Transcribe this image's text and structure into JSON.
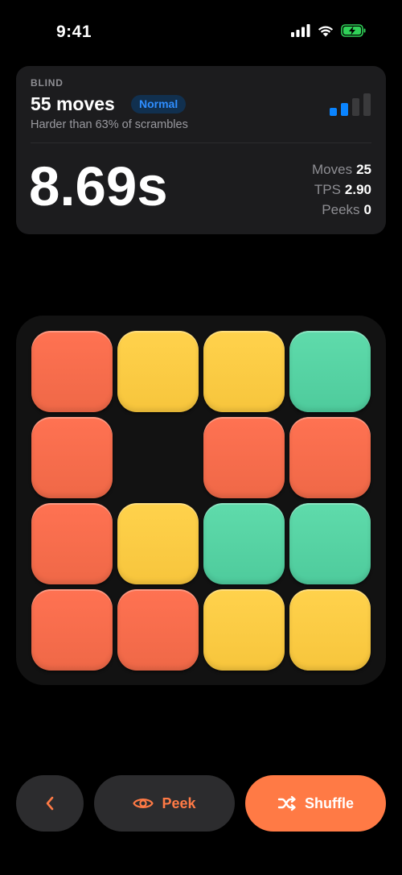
{
  "status_bar": {
    "time": "9:41",
    "icons": [
      "cellular-signal-icon",
      "wifi-icon",
      "battery-charging-icon"
    ],
    "battery_color": "#30d158"
  },
  "stats": {
    "mode": "BLIND",
    "moves_title": "55 moves",
    "difficulty": "Normal",
    "difficulty_sub": "Harder than 63% of scrambles",
    "difficulty_bars": {
      "filled": 2,
      "total": 4,
      "filled_color": "#0a84ff",
      "empty_color": "#3a3a3c"
    },
    "time": "8.69s",
    "side": [
      {
        "label": "Moves",
        "value": "25"
      },
      {
        "label": "TPS",
        "value": "2.90"
      },
      {
        "label": "Peeks",
        "value": "0"
      }
    ]
  },
  "board": {
    "rows": 4,
    "cols": 4,
    "tiles": [
      [
        "red",
        "yellow",
        "yellow",
        "green"
      ],
      [
        "red",
        "empty",
        "red",
        "red"
      ],
      [
        "red",
        "yellow",
        "green",
        "green"
      ],
      [
        "red",
        "red",
        "yellow",
        "yellow"
      ]
    ],
    "colors": {
      "red": "#f76d4d",
      "yellow": "#fccb45",
      "green": "#55d3a3"
    }
  },
  "actions": {
    "back_icon": "chevron-left-icon",
    "peek_icon": "eye-icon",
    "peek_label": "Peek",
    "shuffle_icon": "shuffle-icon",
    "shuffle_label": "Shuffle",
    "accent": "#ff7a45"
  }
}
